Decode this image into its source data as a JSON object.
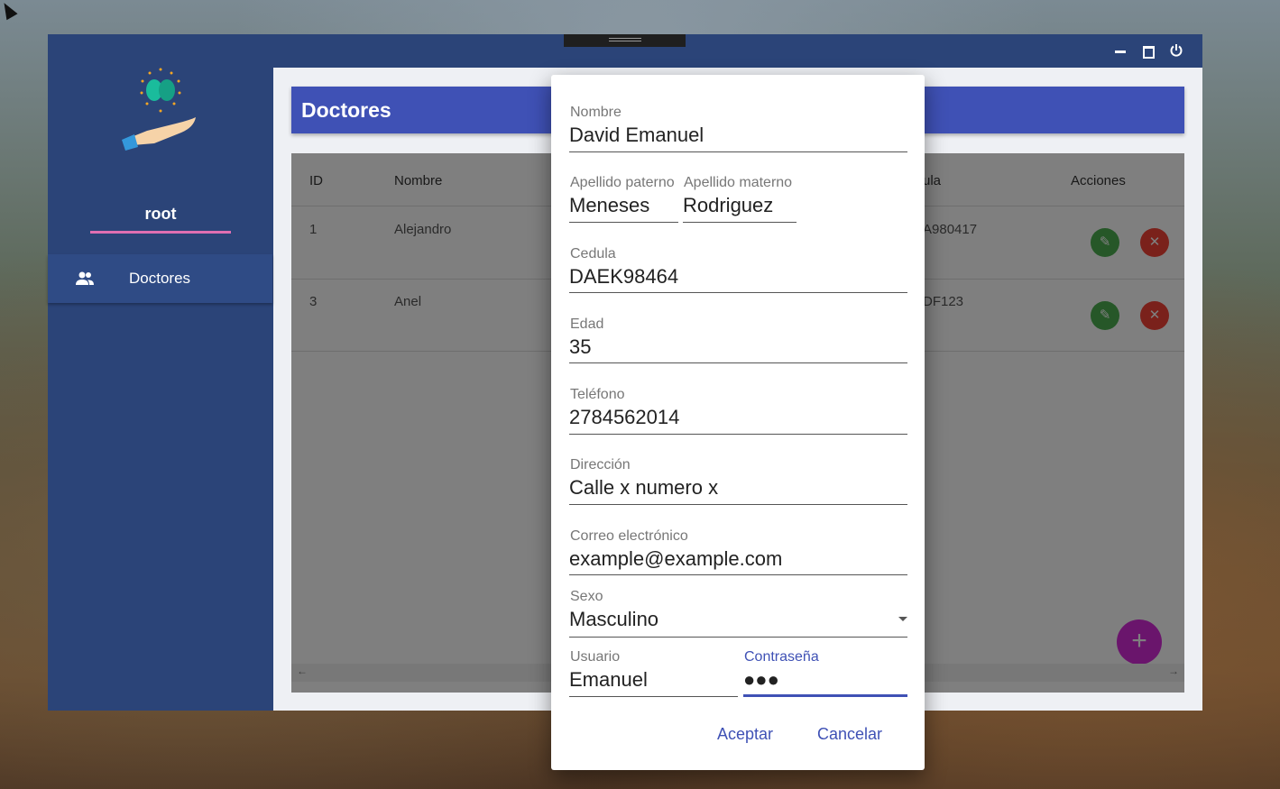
{
  "window": {
    "title_hidden": ""
  },
  "sidebar": {
    "user": "root",
    "items": [
      {
        "label": "Doctores",
        "icon": "people-icon"
      }
    ]
  },
  "header": {
    "title": "Doctores"
  },
  "table": {
    "headers": [
      "ID",
      "Nombre",
      "ula",
      "Acciones"
    ],
    "rows": [
      {
        "id": "1",
        "nombre": "Alejandro",
        "cedula": "A980417"
      },
      {
        "id": "3",
        "nombre": "Anel",
        "cedula": "DF123"
      }
    ]
  },
  "dialog": {
    "nombre": {
      "label": "Nombre",
      "value": "David Emanuel"
    },
    "apellido_paterno": {
      "label": "Apellido paterno",
      "value": "Meneses"
    },
    "apellido_materno": {
      "label": "Apellido materno",
      "value": "Rodriguez"
    },
    "cedula": {
      "label": "Cedula",
      "value": "DAEK98464"
    },
    "edad": {
      "label": "Edad",
      "value": "35"
    },
    "telefono": {
      "label": "Teléfono",
      "value": "2784562014"
    },
    "direccion": {
      "label": "Dirección",
      "value": "Calle x numero x"
    },
    "correo": {
      "label": "Correo electrónico",
      "value": "example@example.com"
    },
    "sexo": {
      "label": "Sexo",
      "value": "Masculino"
    },
    "usuario": {
      "label": "Usuario",
      "value": "Emanuel"
    },
    "contrasena": {
      "label": "Contraseña",
      "value": "●●●"
    },
    "accept_label": "Aceptar",
    "cancel_label": "Cancelar"
  },
  "colors": {
    "sidebar": "#2b4478",
    "header": "#3f51b5",
    "accent": "#3f51b5",
    "underline": "#e06fb2",
    "fab": "#d52bd8",
    "edit": "#4caf50",
    "delete": "#f44336"
  }
}
